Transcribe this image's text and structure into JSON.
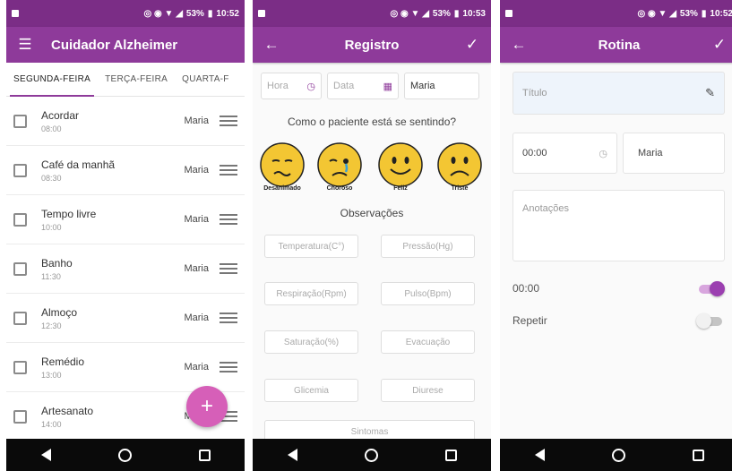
{
  "status": {
    "screen1": {
      "battery": "53%",
      "time": "10:52"
    },
    "screen2": {
      "battery": "53%",
      "time": "10:53"
    },
    "screen3": {
      "battery": "53%",
      "time": "10:52"
    }
  },
  "screen1": {
    "title": "Cuidador Alzheimer",
    "tabs": [
      "SEGUNDA-FEIRA",
      "TERÇA-FEIRA",
      "QUARTA-F"
    ],
    "active_tab": 0,
    "items": [
      {
        "title": "Acordar",
        "time": "08:00",
        "user": "Maria"
      },
      {
        "title": "Café da manhã",
        "time": "08:30",
        "user": "Maria"
      },
      {
        "title": "Tempo livre",
        "time": "10:00",
        "user": "Maria"
      },
      {
        "title": "Banho",
        "time": "11:30",
        "user": "Maria"
      },
      {
        "title": "Almoço",
        "time": "12:30",
        "user": "Maria"
      },
      {
        "title": "Remédio",
        "time": "13:00",
        "user": "Maria"
      },
      {
        "title": "Artesanato",
        "time": "14:00",
        "user": "Maria"
      }
    ],
    "fab_label": "+"
  },
  "screen2": {
    "title": "Registro",
    "hora_placeholder": "Hora",
    "data_placeholder": "Data",
    "user_value": "Maria",
    "question": "Como o paciente está se sentindo?",
    "moods": [
      {
        "label": "Desanimado",
        "mood": "tired"
      },
      {
        "label": "Choroso",
        "mood": "crying"
      },
      {
        "label": "Feliz",
        "mood": "happy"
      },
      {
        "label": "Triste",
        "mood": "sad"
      }
    ],
    "observations_title": "Observações",
    "fields": [
      "Temperatura(C°)",
      "Pressão(Hg)",
      "Respiração(Rpm)",
      "Pulso(Bpm)",
      "Saturação(%)",
      "Evacuação",
      "Glicemia",
      "Diurese",
      "Sintomas"
    ]
  },
  "screen3": {
    "title": "Rotina",
    "titulo_placeholder": "Título",
    "time_value": "00:00",
    "user_value": "Maria",
    "notes_placeholder": "Anotações",
    "alarm_label": "00:00",
    "alarm_on": true,
    "repeat_label": "Repetir",
    "repeat_on": false
  },
  "colors": {
    "status_bar": "#7b2d86",
    "app_bar": "#8e3a9a",
    "accent": "#d65fb8",
    "face": "#f3c633"
  }
}
